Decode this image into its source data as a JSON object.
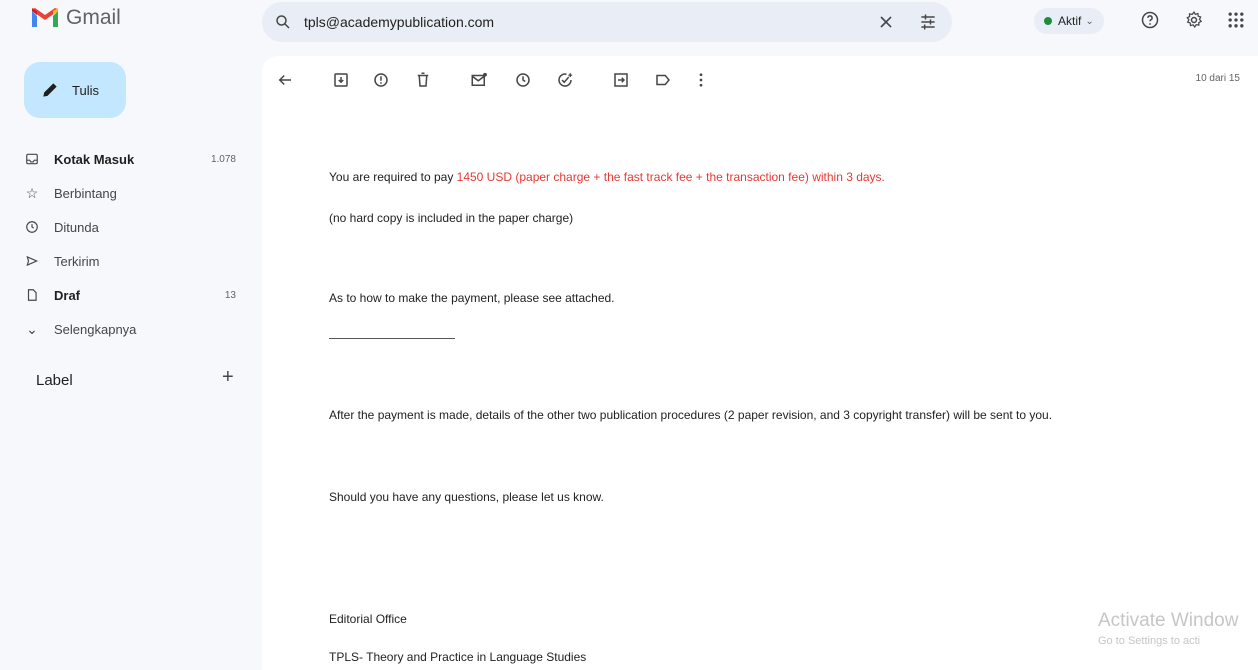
{
  "app": {
    "name": "Gmail"
  },
  "search": {
    "value": "tpls@academypublication.com"
  },
  "status": {
    "label": "Aktif"
  },
  "compose": {
    "label": "Tulis"
  },
  "nav": [
    {
      "label": "Kotak Masuk",
      "count": "1.078",
      "icon": "inbox-icon"
    },
    {
      "label": "Berbintang",
      "count": "",
      "icon": "star-icon"
    },
    {
      "label": "Ditunda",
      "count": "",
      "icon": "clock-icon"
    },
    {
      "label": "Terkirim",
      "count": "",
      "icon": "send-icon"
    },
    {
      "label": "Draf",
      "count": "13",
      "icon": "draft-icon"
    },
    {
      "label": "Selengkapnya",
      "count": "",
      "icon": "chevron-down-icon"
    }
  ],
  "labels": {
    "heading": "Label"
  },
  "toolbar": {
    "pager": "10 dari 15"
  },
  "email": {
    "line1_pre": "You are required to pay ",
    "line1_highlight": "1450 USD (paper charge + the fast track fee + the transaction fee) within 3 days.",
    "line2": "(no hard copy is included in the paper charge)",
    "line3": "As to how to make the payment, please see attached.",
    "line4": "After the payment is made, details of the other two publication procedures (2 paper revision, and 3 copyright transfer) will be sent to you.",
    "line5": "Should you have any questions, please let us know.",
    "signature1": "Editorial Office",
    "signature2": "TPLS- Theory and Practice in Language Studies"
  },
  "watermark": {
    "title": "Activate Window",
    "subtitle": "Go to Settings to acti"
  },
  "colors": {
    "accent": "#c2e7ff",
    "highlight": "#e53935",
    "status_dot": "#1e8e3e",
    "background": "#f6f8fc"
  }
}
